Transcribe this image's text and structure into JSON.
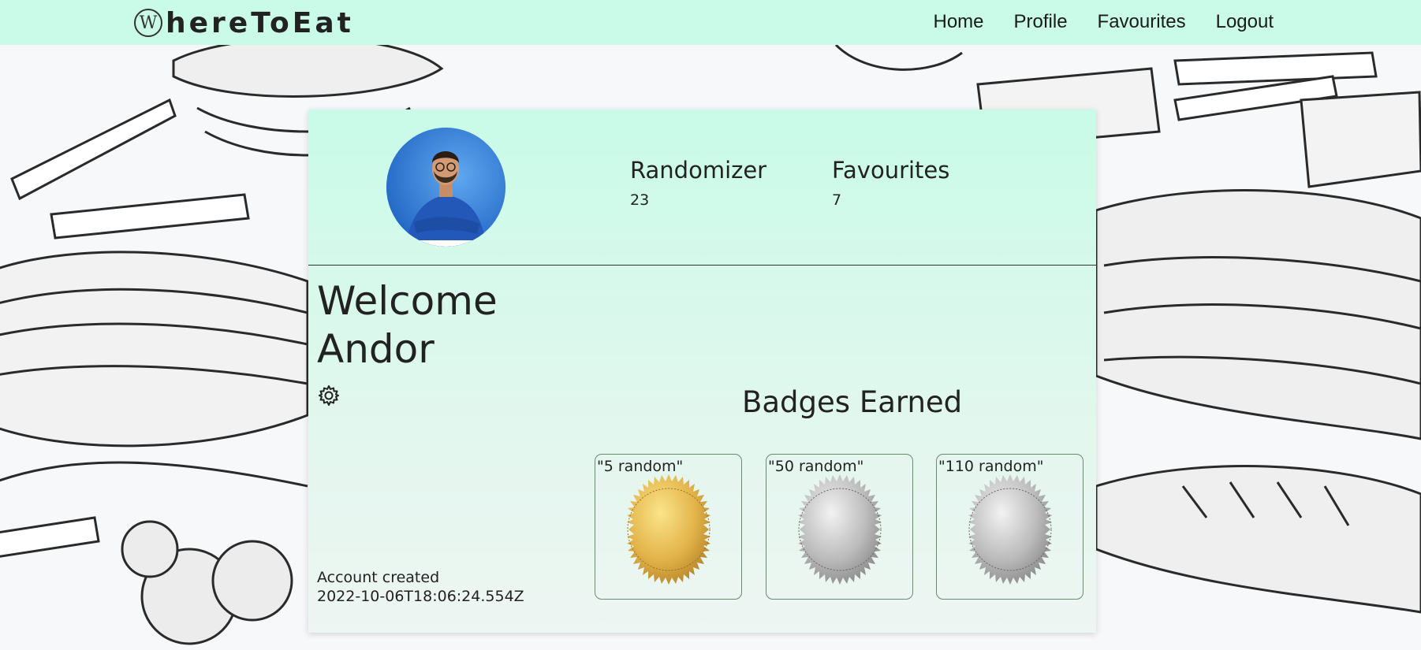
{
  "brand": {
    "logo_letter": "W",
    "name": "hereToEat"
  },
  "nav": {
    "links": [
      "Home",
      "Profile",
      "Favourites",
      "Logout"
    ]
  },
  "profile": {
    "stats": [
      {
        "label": "Randomizer",
        "value": "23"
      },
      {
        "label": "Favourites",
        "value": "7"
      }
    ],
    "welcome_line1": "Welcome",
    "welcome_line2": "Andor",
    "settings_icon": "gear-icon",
    "account_created_label": "Account created",
    "account_created_value": "2022-10-06T18:06:24.554Z"
  },
  "badges": {
    "title": "Badges Earned",
    "items": [
      {
        "label": "\"5 random\"",
        "medal": "gold"
      },
      {
        "label": "\"50 random\"",
        "medal": "silver"
      },
      {
        "label": "\"110 random\"",
        "medal": "silver"
      }
    ]
  },
  "colors": {
    "navbar": "#c9fbe8",
    "card": "#c9fbe8",
    "gold": "#e8b94a",
    "silver": "#c2c2c2"
  }
}
